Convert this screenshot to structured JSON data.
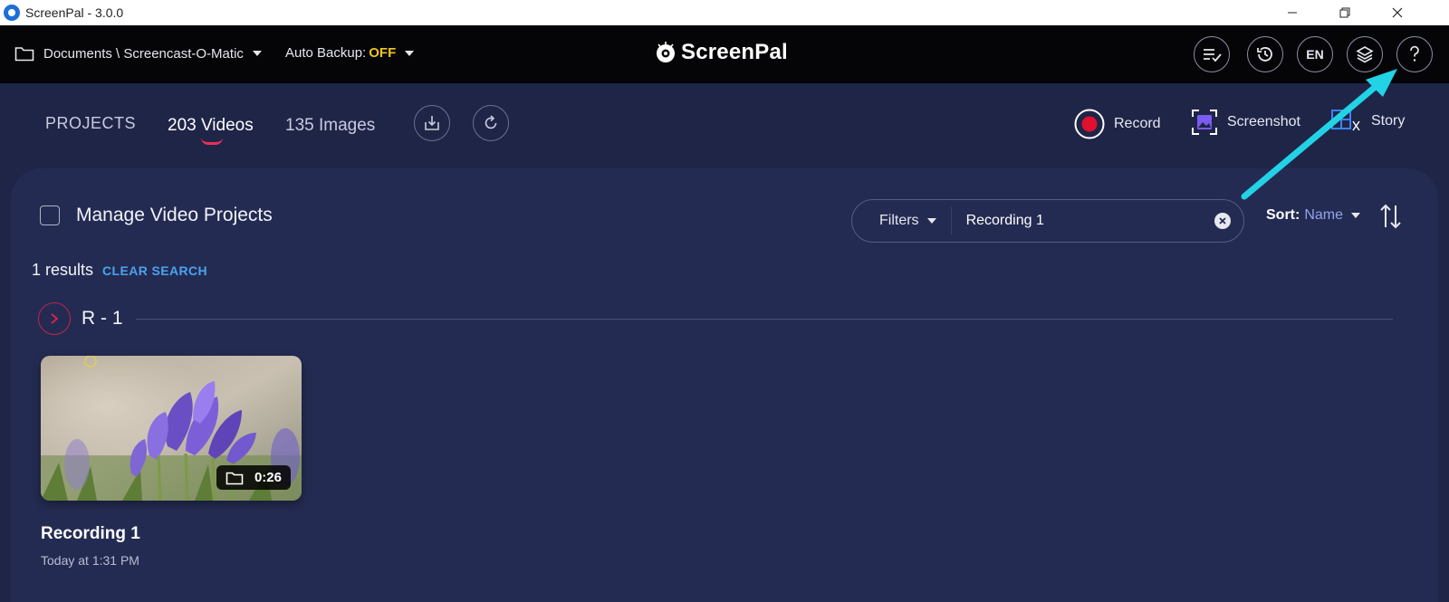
{
  "window": {
    "title": "ScreenPal - 3.0.0",
    "icons": [
      "app-icon",
      "minimize-icon",
      "restore-icon",
      "close-icon"
    ]
  },
  "topbar": {
    "folder_path": "Documents \\ Screencast-O-Matic",
    "backup_label": "Auto Backup:",
    "backup_value": "OFF",
    "brand": "ScreenPal",
    "language": "EN",
    "buttons": [
      "checklist-icon",
      "history-icon",
      "language-button",
      "layers-icon",
      "help-icon"
    ]
  },
  "nav": {
    "projects": "PROJECTS",
    "videos": "203 Videos",
    "images": "135 Images",
    "record": "Record",
    "screenshot": "Screenshot",
    "story": "Story"
  },
  "main": {
    "manage_label": "Manage Video Projects",
    "filters_label": "Filters",
    "search_value": "Recording 1",
    "sort_label": "Sort:",
    "sort_value": "Name",
    "results_count": "1 results",
    "clear_search": "CLEAR SEARCH",
    "group_name": "R - 1",
    "videos": [
      {
        "title": "Recording 1",
        "date": "Today at 1:31 PM",
        "duration": "0:26"
      }
    ]
  },
  "colors": {
    "accent_record": "#e0102e",
    "annotation_arrow": "#22d3e6",
    "backup_off": "#f0c420",
    "link_blue": "#4aa3ef"
  }
}
